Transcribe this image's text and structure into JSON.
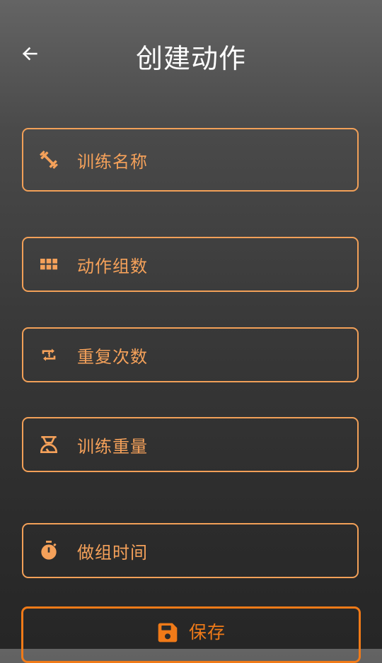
{
  "header": {
    "title": "创建动作",
    "back_icon": "arrow-left-icon"
  },
  "form": {
    "fields": [
      {
        "id": "training-name",
        "label": "训练名称",
        "icon": "dumbbell-icon"
      },
      {
        "id": "sets",
        "label": "动作组数",
        "icon": "grid-icon"
      },
      {
        "id": "reps",
        "label": "重复次数",
        "icon": "repeat-one-icon"
      },
      {
        "id": "weight",
        "label": "训练重量",
        "icon": "scale-icon"
      },
      {
        "id": "set-time",
        "label": "做组时间",
        "icon": "stopwatch-icon"
      }
    ]
  },
  "actions": {
    "save_label": "保存",
    "save_icon": "floppy-disk-icon"
  },
  "colors": {
    "accent": "#f5a15a",
    "save_accent": "#f07a18",
    "text_primary": "#ffffff"
  }
}
